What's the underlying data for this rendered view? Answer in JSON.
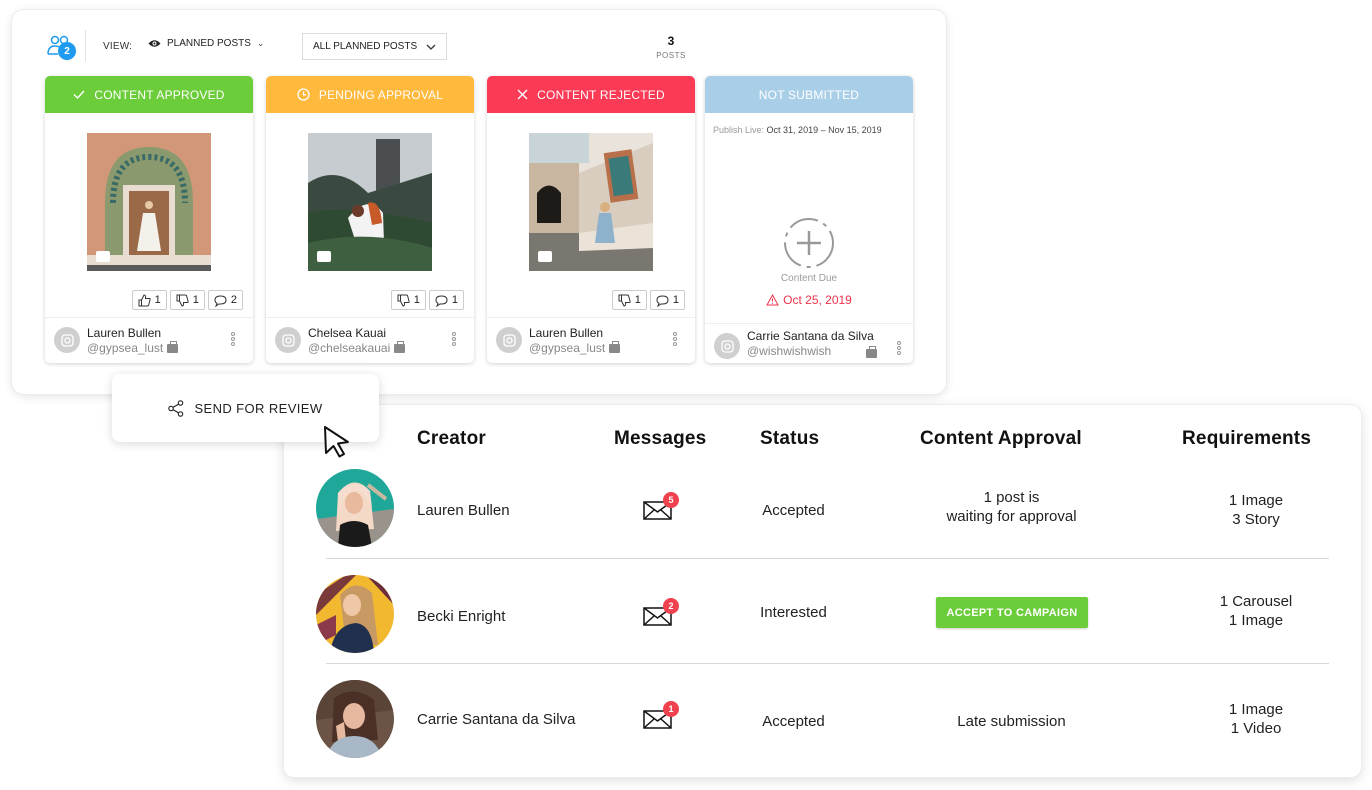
{
  "toolbar": {
    "team_count": "2",
    "view_label": "VIEW:",
    "view_selected": "PLANNED POSTS",
    "filter_selected": "ALL PLANNED POSTS",
    "posts_count": "3",
    "posts_label": "POSTS"
  },
  "colors": {
    "approved": "#6ccd3b",
    "pending": "#ffb93c",
    "rejected": "#fb3a55",
    "not_submitted": "#a9cfe8",
    "alert": "#f0324c",
    "badge": "#f0414e",
    "team_badge": "#1e9bf0"
  },
  "cards": [
    {
      "status": "CONTENT APPROVED",
      "status_icon": "check-icon",
      "media_type": "image",
      "reactions": [
        {
          "type": "thumbs-up",
          "count": "1"
        },
        {
          "type": "thumbs-down",
          "count": "1"
        },
        {
          "type": "comment",
          "count": "2"
        }
      ],
      "creator_name": "Lauren Bullen",
      "creator_handle": "@gypsea_lust"
    },
    {
      "status": "PENDING APPROVAL",
      "status_icon": "clock-icon",
      "media_type": "image",
      "reactions": [
        {
          "type": "thumbs-down",
          "count": "1"
        },
        {
          "type": "comment",
          "count": "1"
        }
      ],
      "creator_name": "Chelsea Kauai",
      "creator_handle": "@chelseakauai"
    },
    {
      "status": "CONTENT REJECTED",
      "status_icon": "x-icon",
      "media_type": "image",
      "reactions": [
        {
          "type": "thumbs-down",
          "count": "1"
        },
        {
          "type": "comment",
          "count": "1"
        }
      ],
      "creator_name": "Lauren Bullen",
      "creator_handle": "@gypsea_lust"
    },
    {
      "status": "NOT SUBMITTED",
      "publish_label": "Publish Live:",
      "publish_range": "Oct 31, 2019 – Nov 15, 2019",
      "content_due_label": "Content Due",
      "due_date": "Oct 25, 2019",
      "creator_name": "Carrie Santana da Silva",
      "creator_handle": "@wishwishwish"
    }
  ],
  "send_review": {
    "label": "SEND FOR REVIEW"
  },
  "table": {
    "headers": [
      "Creator",
      "Messages",
      "Status",
      "Content Approval",
      "Requirements"
    ],
    "rows": [
      {
        "creator": "Lauren Bullen",
        "messages": "5",
        "status": "Accepted",
        "approval_line1": "1 post is",
        "approval_line2": "waiting for approval",
        "req_line1": "1 Image",
        "req_line2": "3 Story"
      },
      {
        "creator": "Becki Enright",
        "messages": "2",
        "status": "Interested",
        "approval_button": "ACCEPT TO CAMPAIGN",
        "req_line1": "1 Carousel",
        "req_line2": "1 Image"
      },
      {
        "creator": "Carrie Santana da Silva",
        "messages": "1",
        "status": "Accepted",
        "approval_text": "Late submission",
        "req_line1": "1 Image",
        "req_line2": "1 Video"
      }
    ]
  }
}
